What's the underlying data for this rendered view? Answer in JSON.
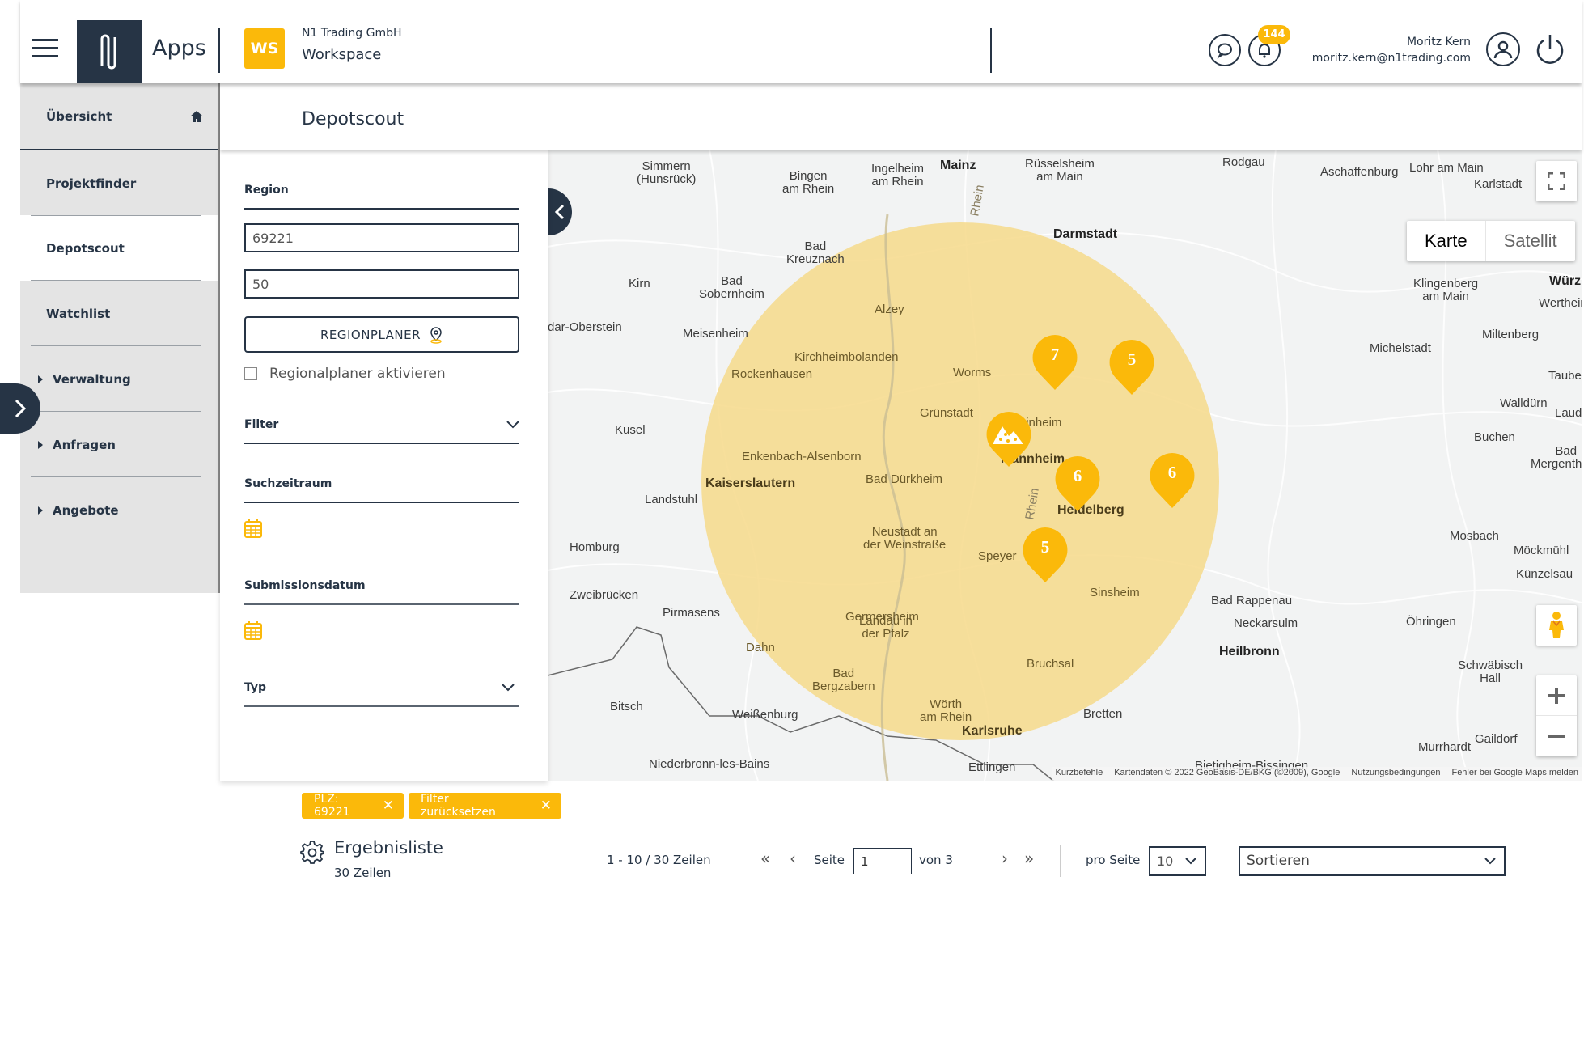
{
  "header": {
    "apps_label": "Apps",
    "workspace_badge": "WS",
    "company": "N1 Trading GmbH",
    "workspace": "Workspace",
    "notification_count": "144",
    "user_name": "Moritz Kern",
    "user_email": "moritz.kern@n1trading.com"
  },
  "sidebar": {
    "items": [
      {
        "label": "Übersicht",
        "icon": "home-icon"
      },
      {
        "label": "Projektfinder"
      },
      {
        "label": "Depotscout",
        "active": true
      },
      {
        "label": "Watchlist"
      },
      {
        "label": "Verwaltung",
        "expandable": true
      },
      {
        "label": "Anfragen",
        "expandable": true
      },
      {
        "label": "Angebote",
        "expandable": true
      }
    ]
  },
  "page": {
    "title": "Depotscout"
  },
  "filters": {
    "region_label": "Region",
    "postal_code": "69221",
    "radius": "50",
    "regionplaner_button": "REGIONPLANER",
    "regionplaner_checkbox": "Regionalplaner aktivieren",
    "regionplaner_checked": false,
    "filter_label": "Filter",
    "suchzeitraum_label": "Suchzeitraum",
    "submissionsdatum_label": "Submissionsdatum",
    "typ_label": "Typ"
  },
  "map": {
    "map_type_options": [
      "Karte",
      "Satellit"
    ],
    "map_type_selected": "Karte",
    "accent_color": "#fbb90a",
    "radius_color": "#f6dc8f",
    "markers": [
      {
        "label": "7",
        "near": "Heppenheim (Bergstraße)"
      },
      {
        "label": "5",
        "near": "Heppenheim east"
      },
      {
        "label": "",
        "icon": "depot-pile-icon",
        "near": "Mannheim"
      },
      {
        "label": "6",
        "near": "Heidelberg"
      },
      {
        "label": "6",
        "near": "Heidelberg east"
      },
      {
        "label": "5",
        "near": "Speyer"
      }
    ],
    "places": [
      {
        "name": "Simmern\n(Hunsrück)"
      },
      {
        "name": "Bingen\nam Rhein"
      },
      {
        "name": "Ingelheim\nam Rhein"
      },
      {
        "name": "Mainz",
        "bold": true
      },
      {
        "name": "Rüsselsheim\nam Main"
      },
      {
        "name": "Rodgau"
      },
      {
        "name": "Aschaffenburg"
      },
      {
        "name": "Lohr am Main"
      },
      {
        "name": "Karlstadt"
      },
      {
        "name": "Darmstadt",
        "bold": true
      },
      {
        "name": "Bad\nKreuznach"
      },
      {
        "name": "Kirn"
      },
      {
        "name": "Bad\nSobernheim"
      },
      {
        "name": "Klingenberg\nam Main"
      },
      {
        "name": "Wertheim"
      },
      {
        "name": "Würzbu",
        "bold": true
      },
      {
        "name": "Alzey"
      },
      {
        "name": "dar-Oberstein"
      },
      {
        "name": "Meisenheim"
      },
      {
        "name": "Miltenberg"
      },
      {
        "name": "Michelstadt"
      },
      {
        "name": "Kirchheimbolanden"
      },
      {
        "name": "Rockenhausen"
      },
      {
        "name": "Worms"
      },
      {
        "name": "Tauberbischofsheim"
      },
      {
        "name": "Walldürn"
      },
      {
        "name": "Grünstadt"
      },
      {
        "name": "Weinheim"
      },
      {
        "name": "Lauda-Königshofen"
      },
      {
        "name": "Kusel"
      },
      {
        "name": "Buchen"
      },
      {
        "name": "Enkenbach-Alsenborn"
      },
      {
        "name": "Mannheim",
        "bold": true
      },
      {
        "name": "Bad\nMergentheim"
      },
      {
        "name": "Kaiserslautern",
        "bold": true
      },
      {
        "name": "Bad Dürkheim"
      },
      {
        "name": "Landstuhl"
      },
      {
        "name": "Heidelberg",
        "bold": true
      },
      {
        "name": "Neustadt an\nder Weinstraße"
      },
      {
        "name": "Mosbach"
      },
      {
        "name": "Homburg"
      },
      {
        "name": "Speyer"
      },
      {
        "name": "Möckmühl"
      },
      {
        "name": "Künzelsau"
      },
      {
        "name": "Sinsheim"
      },
      {
        "name": "Zweibrücken"
      },
      {
        "name": "Bad Rappenau"
      },
      {
        "name": "Pirmasens"
      },
      {
        "name": "Germersheim"
      },
      {
        "name": "Neckarsulm"
      },
      {
        "name": "Öhringen"
      },
      {
        "name": "Landau in\nder Pfalz"
      },
      {
        "name": "Dahn"
      },
      {
        "name": "Heilbronn",
        "bold": true
      },
      {
        "name": "Bruchsal"
      },
      {
        "name": "Schwäbisch\nHall"
      },
      {
        "name": "Bad\nBergzabern"
      },
      {
        "name": "Bitsch"
      },
      {
        "name": "Wörth\nam Rhein"
      },
      {
        "name": "Weißenburg"
      },
      {
        "name": "Bretten"
      },
      {
        "name": "Karlsruhe",
        "bold": true
      },
      {
        "name": "Gaildorf"
      },
      {
        "name": "Murrhardt"
      },
      {
        "name": "Niederbronn-les-Bains"
      },
      {
        "name": "Ettlingen"
      },
      {
        "name": "Bietigheim-Bissingen"
      },
      {
        "name": "Rhein"
      },
      {
        "name": "Rhein"
      }
    ],
    "attribution": {
      "shortcuts": "Kurzbefehle",
      "data": "Kartendaten © 2022 GeoBasis-DE/BKG (©2009), Google",
      "terms": "Nutzungsbedingungen",
      "report": "Fehler bei Google Maps melden"
    }
  },
  "chips": [
    {
      "label": "PLZ: 69221"
    },
    {
      "label": "Filter zurücksetzen"
    }
  ],
  "results": {
    "title": "Ergebnisliste",
    "row_count": "30  Zeilen",
    "range": "1 - 10 / 30  Zeilen",
    "page_label": "Seite",
    "current_page": "1",
    "of_pages": "von 3",
    "per_page_label": "pro Seite",
    "per_page": "10",
    "sort_placeholder": "Sortieren"
  }
}
